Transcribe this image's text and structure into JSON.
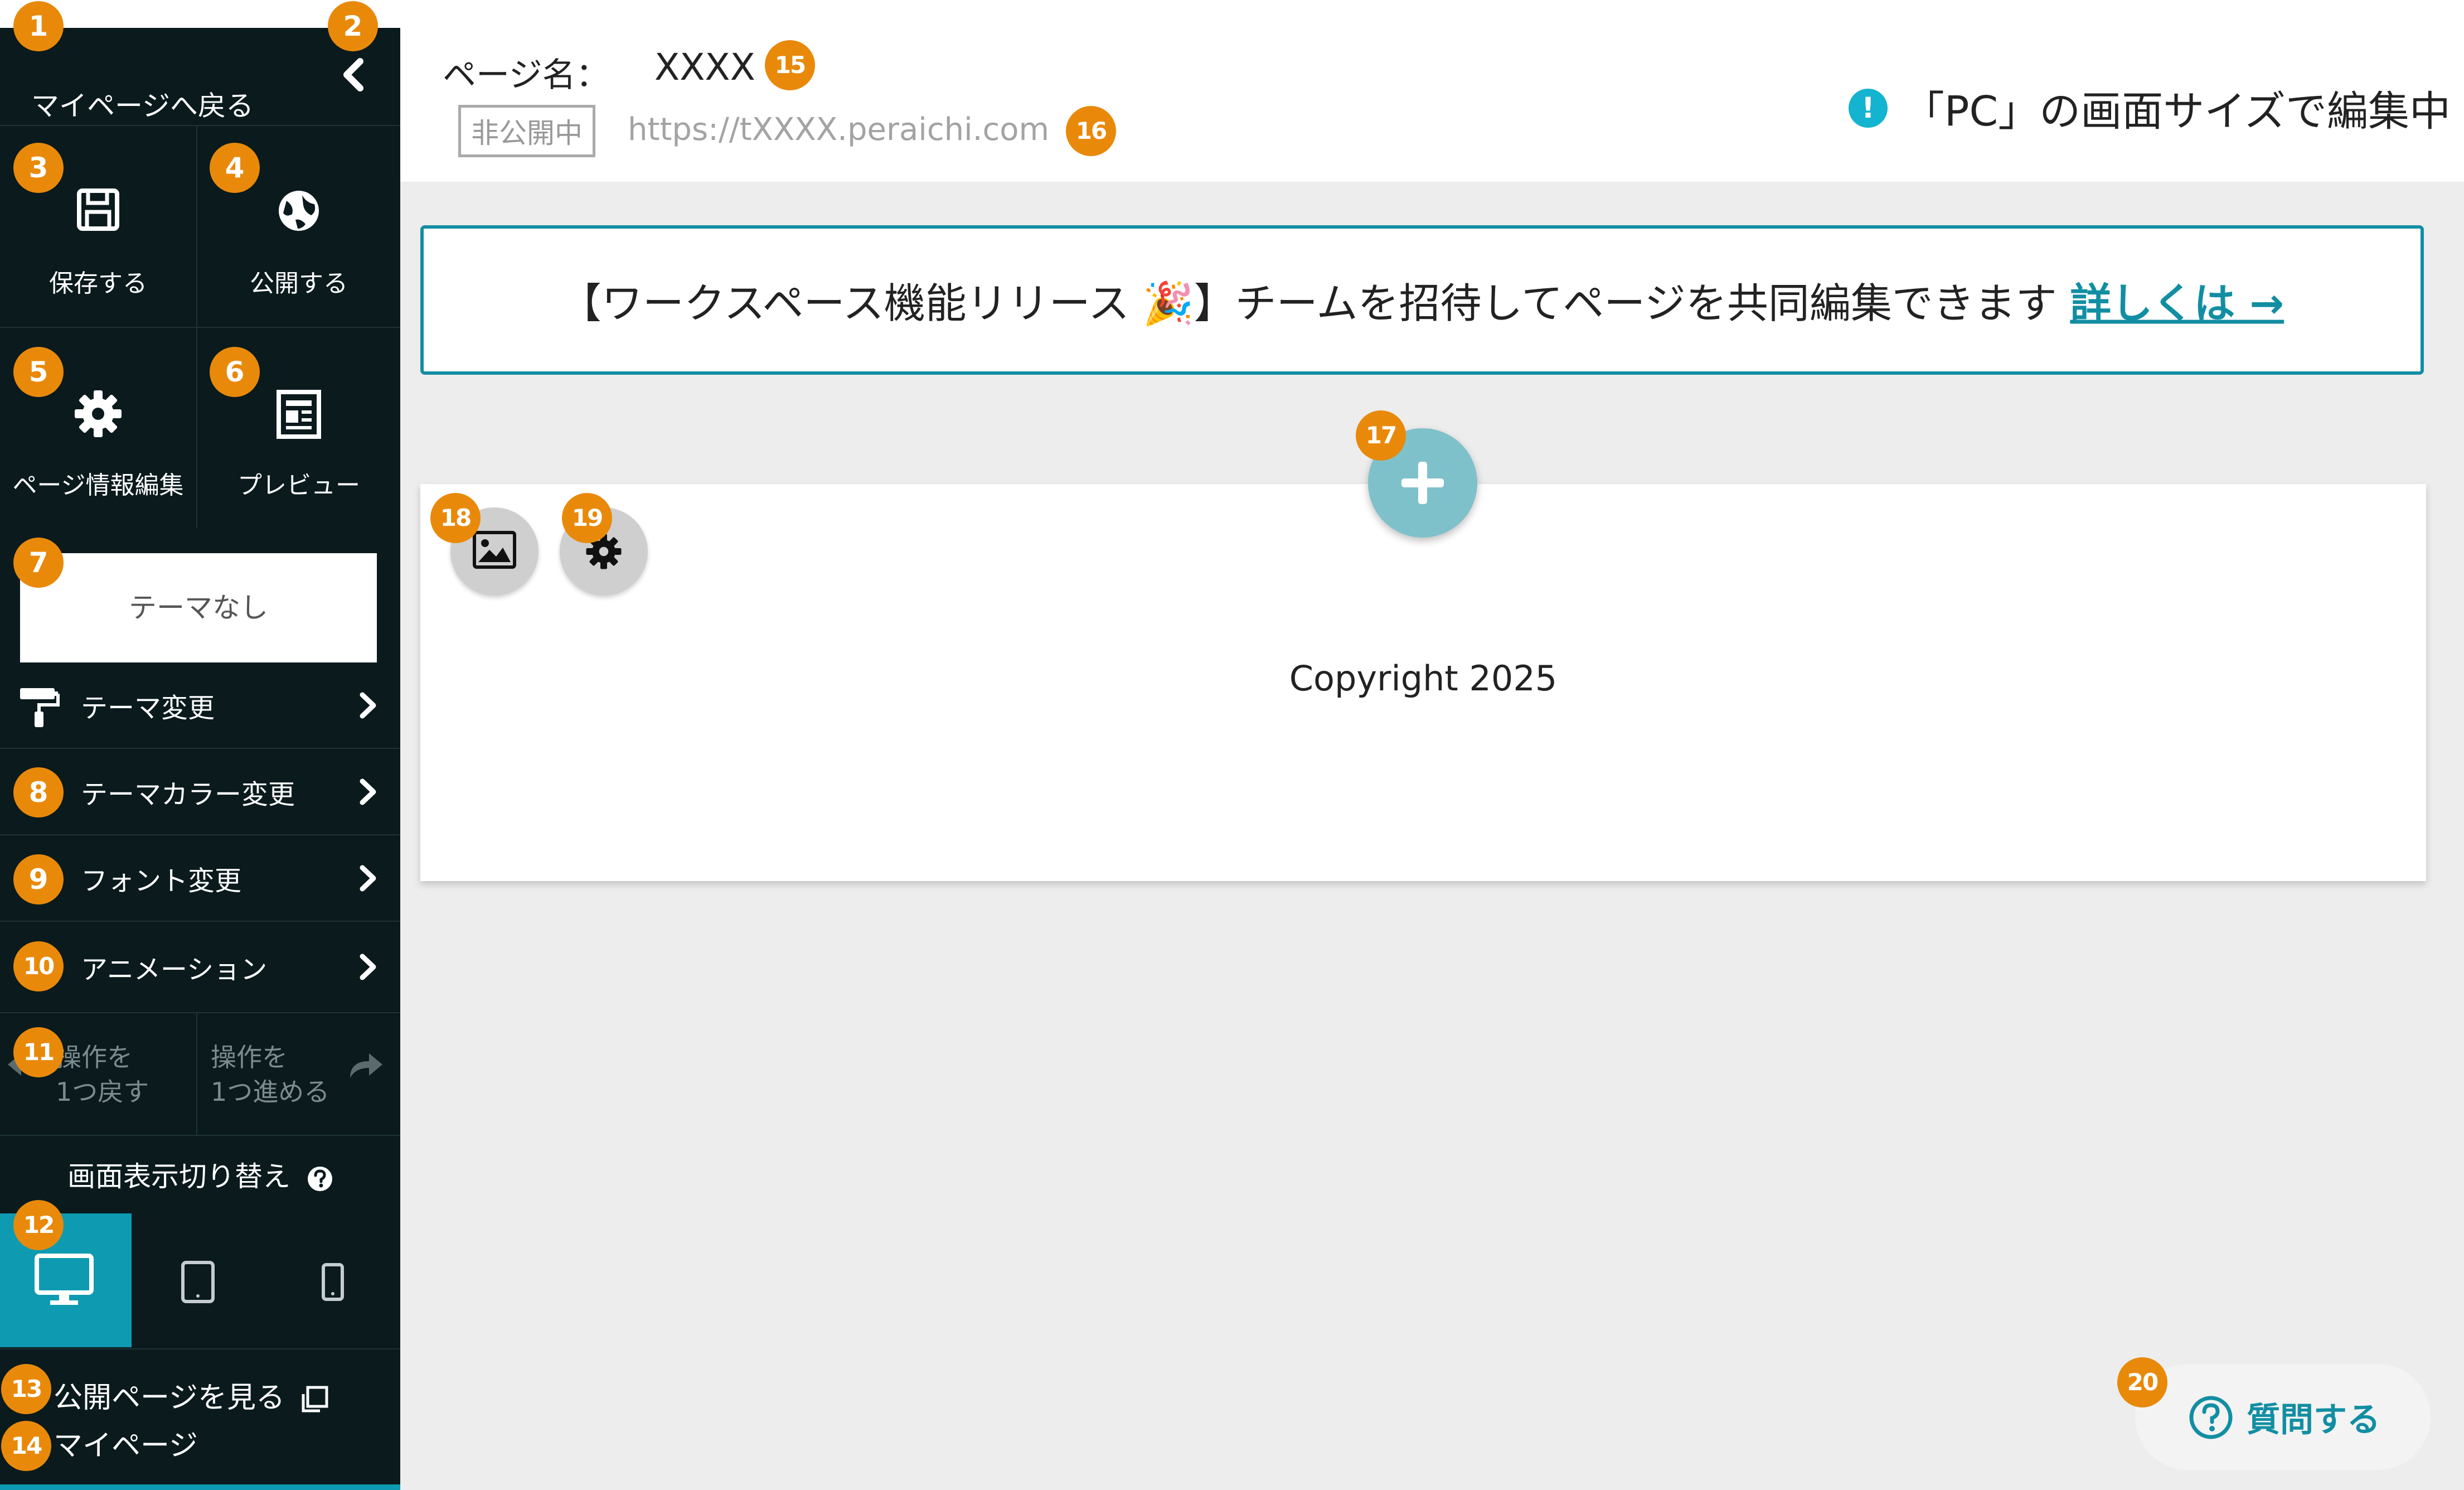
{
  "sidebar": {
    "back_label": "マイページへ戻る",
    "buttons": {
      "save": "保存する",
      "publish": "公開する",
      "page_info": "ページ情報編集",
      "preview": "プレビュー"
    },
    "theme_current": "テーマなし",
    "menu": {
      "theme_change": "テーマ変更",
      "theme_color": "テーマカラー変更",
      "font_change": "フォント変更",
      "animation": "アニメーション"
    },
    "undo": {
      "line1": "操作を",
      "line2": "1つ戻す"
    },
    "redo": {
      "line1": "操作を",
      "line2": "1つ進める"
    },
    "view_switch_title": "画面表示切り替え",
    "view_selected": "pc",
    "public_page_link": "公開ページを見る",
    "mypage_link": "マイページ"
  },
  "header": {
    "page_name_label": "ページ名：",
    "page_name_value": "XXXX",
    "status_badge": "非公開中",
    "page_url": "https://tXXXX.peraichi.com",
    "size_notice": "「PC」の画面サイズで編集中"
  },
  "banner": {
    "text": "【ワークスペース機能リリース 🎉】チームを招待してページを共同編集できます",
    "link": "詳しくは →"
  },
  "canvas": {
    "copyright": "Copyright 2025"
  },
  "help_button": "質問する",
  "badges": [
    "1",
    "2",
    "3",
    "4",
    "5",
    "6",
    "7",
    "8",
    "9",
    "10",
    "11",
    "12",
    "13",
    "14",
    "15",
    "16",
    "17",
    "18",
    "19",
    "20"
  ],
  "colors": {
    "sidebar_bg": "#0a1a1d",
    "accent": "#0e9bb1",
    "badge": "#e9890a",
    "add_button": "#7ec1cb"
  }
}
